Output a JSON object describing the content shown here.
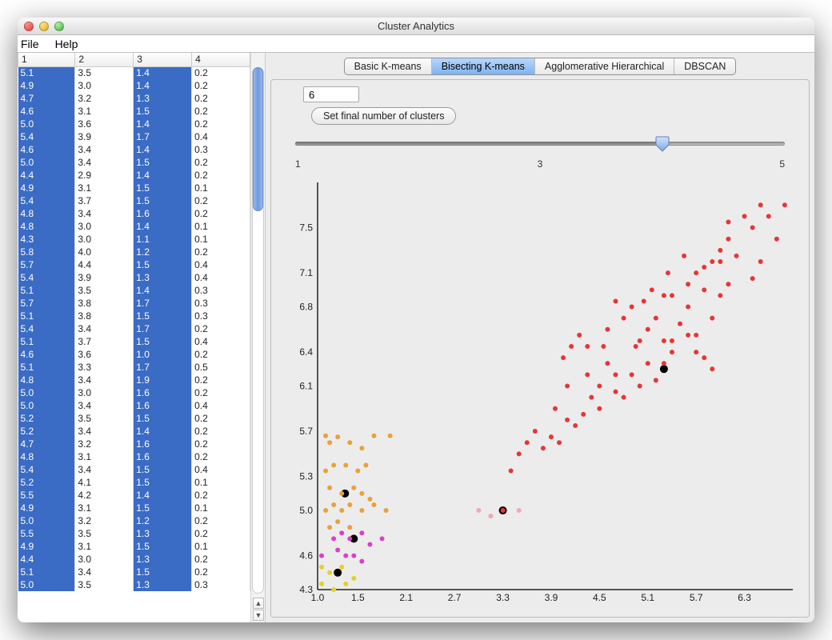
{
  "window": {
    "title": "Cluster Analytics"
  },
  "menu": {
    "file": "File",
    "help": "Help"
  },
  "tabs": [
    {
      "label": "Basic K-means",
      "active": false
    },
    {
      "label": "Bisecting K-means",
      "active": true
    },
    {
      "label": "Agglomerative Hierarchical",
      "active": false
    },
    {
      "label": "DBSCAN",
      "active": false
    }
  ],
  "controls": {
    "cluster_input_value": "6",
    "set_clusters_label": "Set final number of clusters",
    "slider": {
      "min": "1",
      "mid": "3",
      "max": "5",
      "value": 4,
      "range_min": 1,
      "range_max": 5
    }
  },
  "table": {
    "columns": [
      "1",
      "2",
      "3",
      "4"
    ],
    "selected_columns": [
      0,
      2
    ],
    "rows": [
      [
        "5.1",
        "3.5",
        "1.4",
        "0.2"
      ],
      [
        "4.9",
        "3.0",
        "1.4",
        "0.2"
      ],
      [
        "4.7",
        "3.2",
        "1.3",
        "0.2"
      ],
      [
        "4.6",
        "3.1",
        "1.5",
        "0.2"
      ],
      [
        "5.0",
        "3.6",
        "1.4",
        "0.2"
      ],
      [
        "5.4",
        "3.9",
        "1.7",
        "0.4"
      ],
      [
        "4.6",
        "3.4",
        "1.4",
        "0.3"
      ],
      [
        "5.0",
        "3.4",
        "1.5",
        "0.2"
      ],
      [
        "4.4",
        "2.9",
        "1.4",
        "0.2"
      ],
      [
        "4.9",
        "3.1",
        "1.5",
        "0.1"
      ],
      [
        "5.4",
        "3.7",
        "1.5",
        "0.2"
      ],
      [
        "4.8",
        "3.4",
        "1.6",
        "0.2"
      ],
      [
        "4.8",
        "3.0",
        "1.4",
        "0.1"
      ],
      [
        "4.3",
        "3.0",
        "1.1",
        "0.1"
      ],
      [
        "5.8",
        "4.0",
        "1.2",
        "0.2"
      ],
      [
        "5.7",
        "4.4",
        "1.5",
        "0.4"
      ],
      [
        "5.4",
        "3.9",
        "1.3",
        "0.4"
      ],
      [
        "5.1",
        "3.5",
        "1.4",
        "0.3"
      ],
      [
        "5.7",
        "3.8",
        "1.7",
        "0.3"
      ],
      [
        "5.1",
        "3.8",
        "1.5",
        "0.3"
      ],
      [
        "5.4",
        "3.4",
        "1.7",
        "0.2"
      ],
      [
        "5.1",
        "3.7",
        "1.5",
        "0.4"
      ],
      [
        "4.6",
        "3.6",
        "1.0",
        "0.2"
      ],
      [
        "5.1",
        "3.3",
        "1.7",
        "0.5"
      ],
      [
        "4.8",
        "3.4",
        "1.9",
        "0.2"
      ],
      [
        "5.0",
        "3.0",
        "1.6",
        "0.2"
      ],
      [
        "5.0",
        "3.4",
        "1.6",
        "0.4"
      ],
      [
        "5.2",
        "3.5",
        "1.5",
        "0.2"
      ],
      [
        "5.2",
        "3.4",
        "1.4",
        "0.2"
      ],
      [
        "4.7",
        "3.2",
        "1.6",
        "0.2"
      ],
      [
        "4.8",
        "3.1",
        "1.6",
        "0.2"
      ],
      [
        "5.4",
        "3.4",
        "1.5",
        "0.4"
      ],
      [
        "5.2",
        "4.1",
        "1.5",
        "0.1"
      ],
      [
        "5.5",
        "4.2",
        "1.4",
        "0.2"
      ],
      [
        "4.9",
        "3.1",
        "1.5",
        "0.1"
      ],
      [
        "5.0",
        "3.2",
        "1.2",
        "0.2"
      ],
      [
        "5.5",
        "3.5",
        "1.3",
        "0.2"
      ],
      [
        "4.9",
        "3.1",
        "1.5",
        "0.1"
      ],
      [
        "4.4",
        "3.0",
        "1.3",
        "0.2"
      ],
      [
        "5.1",
        "3.4",
        "1.5",
        "0.2"
      ],
      [
        "5.0",
        "3.5",
        "1.3",
        "0.3"
      ]
    ]
  },
  "chart_data": {
    "type": "scatter",
    "xlim": [
      1.0,
      6.9
    ],
    "ylim": [
      4.3,
      7.9
    ],
    "xticks": [
      1.0,
      1.5,
      2.1,
      2.7,
      3.3,
      3.9,
      4.5,
      5.1,
      5.7,
      6.3
    ],
    "yticks": [
      4.3,
      4.6,
      5.0,
      5.3,
      5.7,
      6.1,
      6.4,
      6.8,
      7.1,
      7.5
    ],
    "series": [
      {
        "name": "centroids",
        "color": "#000000",
        "size": 5,
        "points": [
          [
            1.34,
            5.15
          ],
          [
            1.45,
            4.75
          ],
          [
            1.25,
            4.45
          ],
          [
            3.3,
            5.0
          ],
          [
            5.3,
            6.25
          ]
        ]
      },
      {
        "name": "cluster-red",
        "color": "#e63636",
        "size": 3,
        "points": [
          [
            6.8,
            7.7
          ],
          [
            6.6,
            7.6
          ],
          [
            6.7,
            7.4
          ],
          [
            6.5,
            7.7
          ],
          [
            6.4,
            7.5
          ],
          [
            6.3,
            7.6
          ],
          [
            6.1,
            7.4
          ],
          [
            6.0,
            7.2
          ],
          [
            6.1,
            7.0
          ],
          [
            6.5,
            7.2
          ],
          [
            6.4,
            7.05
          ],
          [
            5.9,
            7.2
          ],
          [
            5.7,
            7.1
          ],
          [
            5.8,
            6.95
          ],
          [
            5.6,
            6.8
          ],
          [
            5.5,
            6.65
          ],
          [
            5.3,
            6.9
          ],
          [
            5.2,
            6.7
          ],
          [
            5.1,
            6.6
          ],
          [
            5.0,
            6.5
          ],
          [
            5.4,
            6.5
          ],
          [
            5.6,
            6.55
          ],
          [
            5.7,
            6.4
          ],
          [
            5.8,
            6.35
          ],
          [
            5.9,
            6.25
          ],
          [
            5.3,
            6.3
          ],
          [
            5.2,
            6.15
          ],
          [
            5.0,
            6.1
          ],
          [
            4.9,
            6.2
          ],
          [
            4.8,
            6.0
          ],
          [
            4.7,
            6.05
          ],
          [
            4.6,
            6.3
          ],
          [
            4.5,
            5.9
          ],
          [
            4.4,
            6.0
          ],
          [
            4.3,
            5.85
          ],
          [
            4.2,
            5.75
          ],
          [
            4.1,
            5.8
          ],
          [
            4.0,
            5.6
          ],
          [
            3.9,
            5.65
          ],
          [
            3.8,
            5.55
          ],
          [
            3.7,
            5.7
          ],
          [
            3.6,
            5.6
          ],
          [
            3.5,
            5.5
          ],
          [
            3.4,
            5.35
          ],
          [
            3.3,
            5.0
          ],
          [
            4.05,
            6.35
          ],
          [
            4.15,
            6.45
          ],
          [
            4.25,
            6.55
          ],
          [
            4.35,
            6.45
          ],
          [
            4.6,
            6.6
          ],
          [
            4.8,
            6.7
          ],
          [
            4.9,
            6.8
          ],
          [
            5.05,
            6.85
          ],
          [
            5.4,
            6.9
          ],
          [
            5.6,
            7.0
          ],
          [
            5.8,
            7.15
          ],
          [
            6.0,
            7.3
          ],
          [
            6.2,
            7.25
          ],
          [
            6.0,
            6.9
          ],
          [
            5.9,
            6.7
          ],
          [
            5.7,
            6.55
          ],
          [
            5.4,
            6.4
          ],
          [
            5.1,
            6.3
          ],
          [
            5.3,
            6.5
          ],
          [
            4.95,
            6.45
          ],
          [
            4.7,
            6.2
          ],
          [
            4.5,
            6.1
          ],
          [
            4.35,
            6.2
          ],
          [
            4.1,
            6.1
          ],
          [
            3.95,
            5.9
          ],
          [
            4.55,
            6.45
          ],
          [
            4.7,
            6.85
          ],
          [
            5.15,
            6.95
          ],
          [
            5.35,
            7.1
          ],
          [
            5.55,
            7.25
          ],
          [
            6.1,
            7.55
          ]
        ]
      },
      {
        "name": "cluster-orange",
        "color": "#e8a23a",
        "size": 3,
        "points": [
          [
            1.1,
            5.66
          ],
          [
            1.15,
            5.6
          ],
          [
            1.25,
            5.65
          ],
          [
            1.4,
            5.6
          ],
          [
            1.55,
            5.55
          ],
          [
            1.7,
            5.66
          ],
          [
            1.9,
            5.66
          ],
          [
            1.1,
            5.35
          ],
          [
            1.2,
            5.4
          ],
          [
            1.35,
            5.4
          ],
          [
            1.5,
            5.35
          ],
          [
            1.6,
            5.4
          ],
          [
            1.15,
            5.2
          ],
          [
            1.3,
            5.15
          ],
          [
            1.45,
            5.2
          ],
          [
            1.55,
            5.15
          ],
          [
            1.65,
            5.1
          ],
          [
            1.1,
            5.0
          ],
          [
            1.2,
            5.05
          ],
          [
            1.3,
            5.0
          ],
          [
            1.4,
            5.05
          ],
          [
            1.55,
            5.0
          ],
          [
            1.7,
            5.05
          ],
          [
            1.85,
            5.0
          ],
          [
            1.15,
            4.85
          ],
          [
            1.25,
            4.9
          ],
          [
            1.4,
            4.85
          ]
        ]
      },
      {
        "name": "cluster-magenta",
        "color": "#db3fc9",
        "size": 3,
        "points": [
          [
            1.2,
            4.75
          ],
          [
            1.3,
            4.8
          ],
          [
            1.4,
            4.75
          ],
          [
            1.55,
            4.8
          ],
          [
            1.65,
            4.7
          ],
          [
            1.8,
            4.75
          ],
          [
            1.25,
            4.65
          ],
          [
            1.35,
            4.6
          ],
          [
            1.45,
            4.6
          ],
          [
            1.55,
            4.55
          ],
          [
            1.05,
            4.6
          ]
        ]
      },
      {
        "name": "cluster-yellow",
        "color": "#e4d02a",
        "size": 3,
        "points": [
          [
            1.05,
            4.5
          ],
          [
            1.15,
            4.45
          ],
          [
            1.3,
            4.5
          ],
          [
            1.45,
            4.4
          ],
          [
            1.05,
            4.35
          ],
          [
            1.2,
            4.3
          ],
          [
            1.35,
            4.35
          ]
        ]
      },
      {
        "name": "cluster-pink",
        "color": "#f1a7b3",
        "size": 3,
        "points": [
          [
            3.0,
            5.0
          ],
          [
            3.15,
            4.95
          ],
          [
            3.5,
            5.0
          ]
        ]
      }
    ]
  }
}
